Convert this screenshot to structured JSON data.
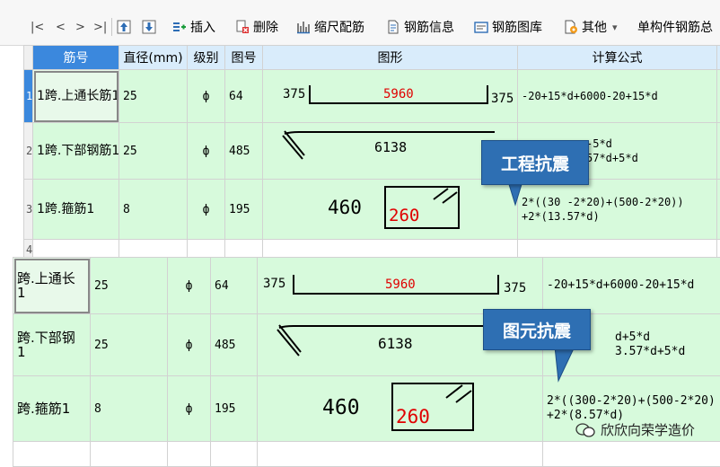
{
  "toolbar": {
    "nav": [
      "|<",
      "<",
      ">",
      ">|"
    ],
    "insert": "插入",
    "delete": "删除",
    "scale": "缩尺配筋",
    "info": "钢筋信息",
    "library": "钢筋图库",
    "other": "其他",
    "other_arrow": "▾",
    "single": "单构件钢筋总"
  },
  "headers": {
    "name": "筋号",
    "diameter": "直径(mm)",
    "grade": "级别",
    "fig": "图号",
    "shape": "图形",
    "formula": "计算公式"
  },
  "top_rows": [
    {
      "rownum": "1",
      "name": "1跨.上通长筋1",
      "diameter": "25",
      "grade": "ф",
      "fig": "64",
      "formula": "-20+15*d+6000-20+15*d",
      "extra": "1"
    },
    {
      "rownum": "2",
      "name": "1跨.下部钢筋1",
      "diameter": "25",
      "grade": "ф",
      "fig": "485",
      "formula": "-5*d\n57*d+5*d",
      "extra": "1"
    },
    {
      "rownum": "3",
      "name": "1跨.箍筋1",
      "diameter": "8",
      "grade": "ф",
      "fig": "195",
      "formula": "2*((30 -2*20)+(500-2*20))\n+2*(13.57*d)",
      "extra": ""
    },
    {
      "rownum": "4",
      "name": "",
      "diameter": "",
      "grade": "",
      "fig": "",
      "formula": "",
      "extra": ""
    }
  ],
  "bottom_rows": [
    {
      "name": "跨.上通长\n1",
      "diameter": "25",
      "grade": "ф",
      "fig": "64",
      "formula": "-20+15*d+6000-20+15*d"
    },
    {
      "name": "跨.下部钢\n1",
      "diameter": "25",
      "grade": "ф",
      "fig": "485",
      "formula": "d+5*d\n3.57*d+5*d"
    },
    {
      "name": "跨.箍筋1",
      "diameter": "8",
      "grade": "ф",
      "fig": "195",
      "formula": "2*((300-2*20)+(500-2*20)\n+2*(8.57*d)"
    }
  ],
  "shapes": {
    "straight": {
      "left": "375",
      "middle": "5960",
      "right": "375"
    },
    "bent": {
      "length": "6138"
    },
    "stirrup": {
      "width": "460",
      "height": "260"
    }
  },
  "callouts": {
    "top": "工程抗震",
    "bottom": "图元抗震"
  },
  "watermark": "欣欣向荣学造价",
  "colors": {
    "row_bg": "#d7fadc",
    "header_bg": "#d9ecfb",
    "callout": "#2e6fb3",
    "dim_red": "#e00000"
  }
}
